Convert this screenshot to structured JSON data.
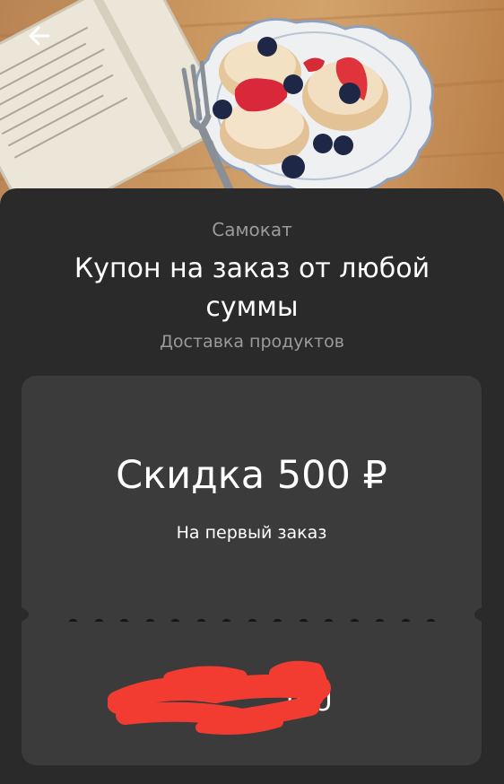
{
  "header": {
    "back_icon": "arrow-left-icon",
    "hero_image": "breakfast-pancakes-photo"
  },
  "offer": {
    "brand": "Самокат",
    "title": "Купон на заказ от любой суммы",
    "category": "Доставка продуктов"
  },
  "coupon": {
    "discount": "Скидка 500 ₽",
    "condition": "На первый заказ",
    "code_visible_part": "J8U"
  },
  "colors": {
    "background": "#1f1f1f",
    "sheet": "#2a2a2a",
    "coupon": "#3b3b3b",
    "redaction": "#f23c32"
  }
}
